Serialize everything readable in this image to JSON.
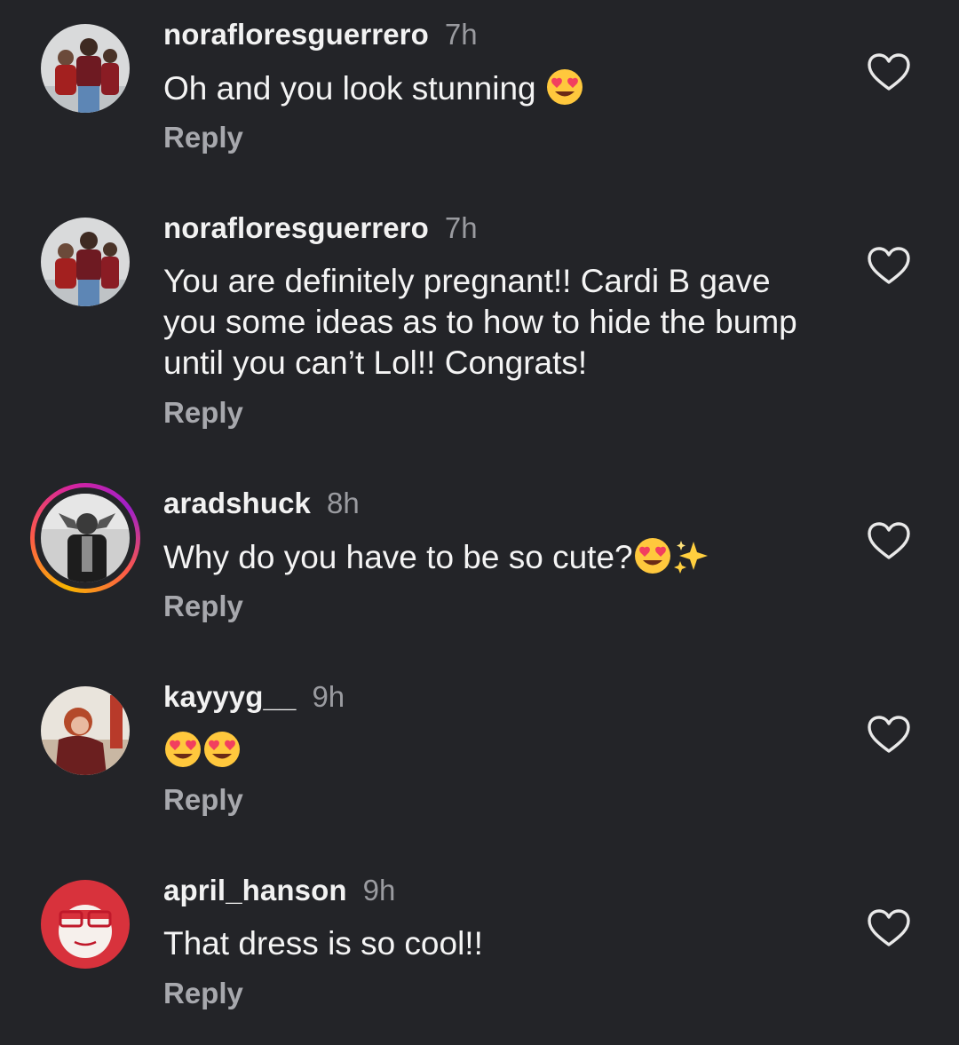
{
  "reply_label": "Reply",
  "colors": {
    "background": "#232428",
    "username": "#f2f2f2",
    "time": "#9a9ba0",
    "reply": "#a7a8ad",
    "story_ring": [
      "#f7b500",
      "#fd5949",
      "#d6249f"
    ]
  },
  "comments": [
    {
      "username": "norafloresguerrero",
      "time": "7h",
      "text": "Oh and you look stunning",
      "emojis": [
        "heart-eyes"
      ],
      "avatar": "group-photo",
      "story_ring": false
    },
    {
      "username": "norafloresguerrero",
      "time": "7h",
      "text": "You are definitely pregnant!! Cardi B gave you some ideas as to how to hide the bump until you can’t Lol!! Congrats!",
      "emojis": [],
      "avatar": "group-photo",
      "story_ring": false
    },
    {
      "username": "aradshuck",
      "time": "8h",
      "text": "Why do you have to be so cute?",
      "emojis": [
        "heart-eyes",
        "sparkles"
      ],
      "avatar": "bw-portrait",
      "story_ring": true
    },
    {
      "username": "kayyyg__",
      "time": "9h",
      "text": "",
      "emojis": [
        "heart-eyes",
        "heart-eyes"
      ],
      "avatar": "redhead-portrait",
      "story_ring": false
    },
    {
      "username": "april_hanson",
      "time": "9h",
      "text": "That dress is so cool!!",
      "emojis": [],
      "avatar": "red-glasses-portrait",
      "story_ring": false
    }
  ]
}
